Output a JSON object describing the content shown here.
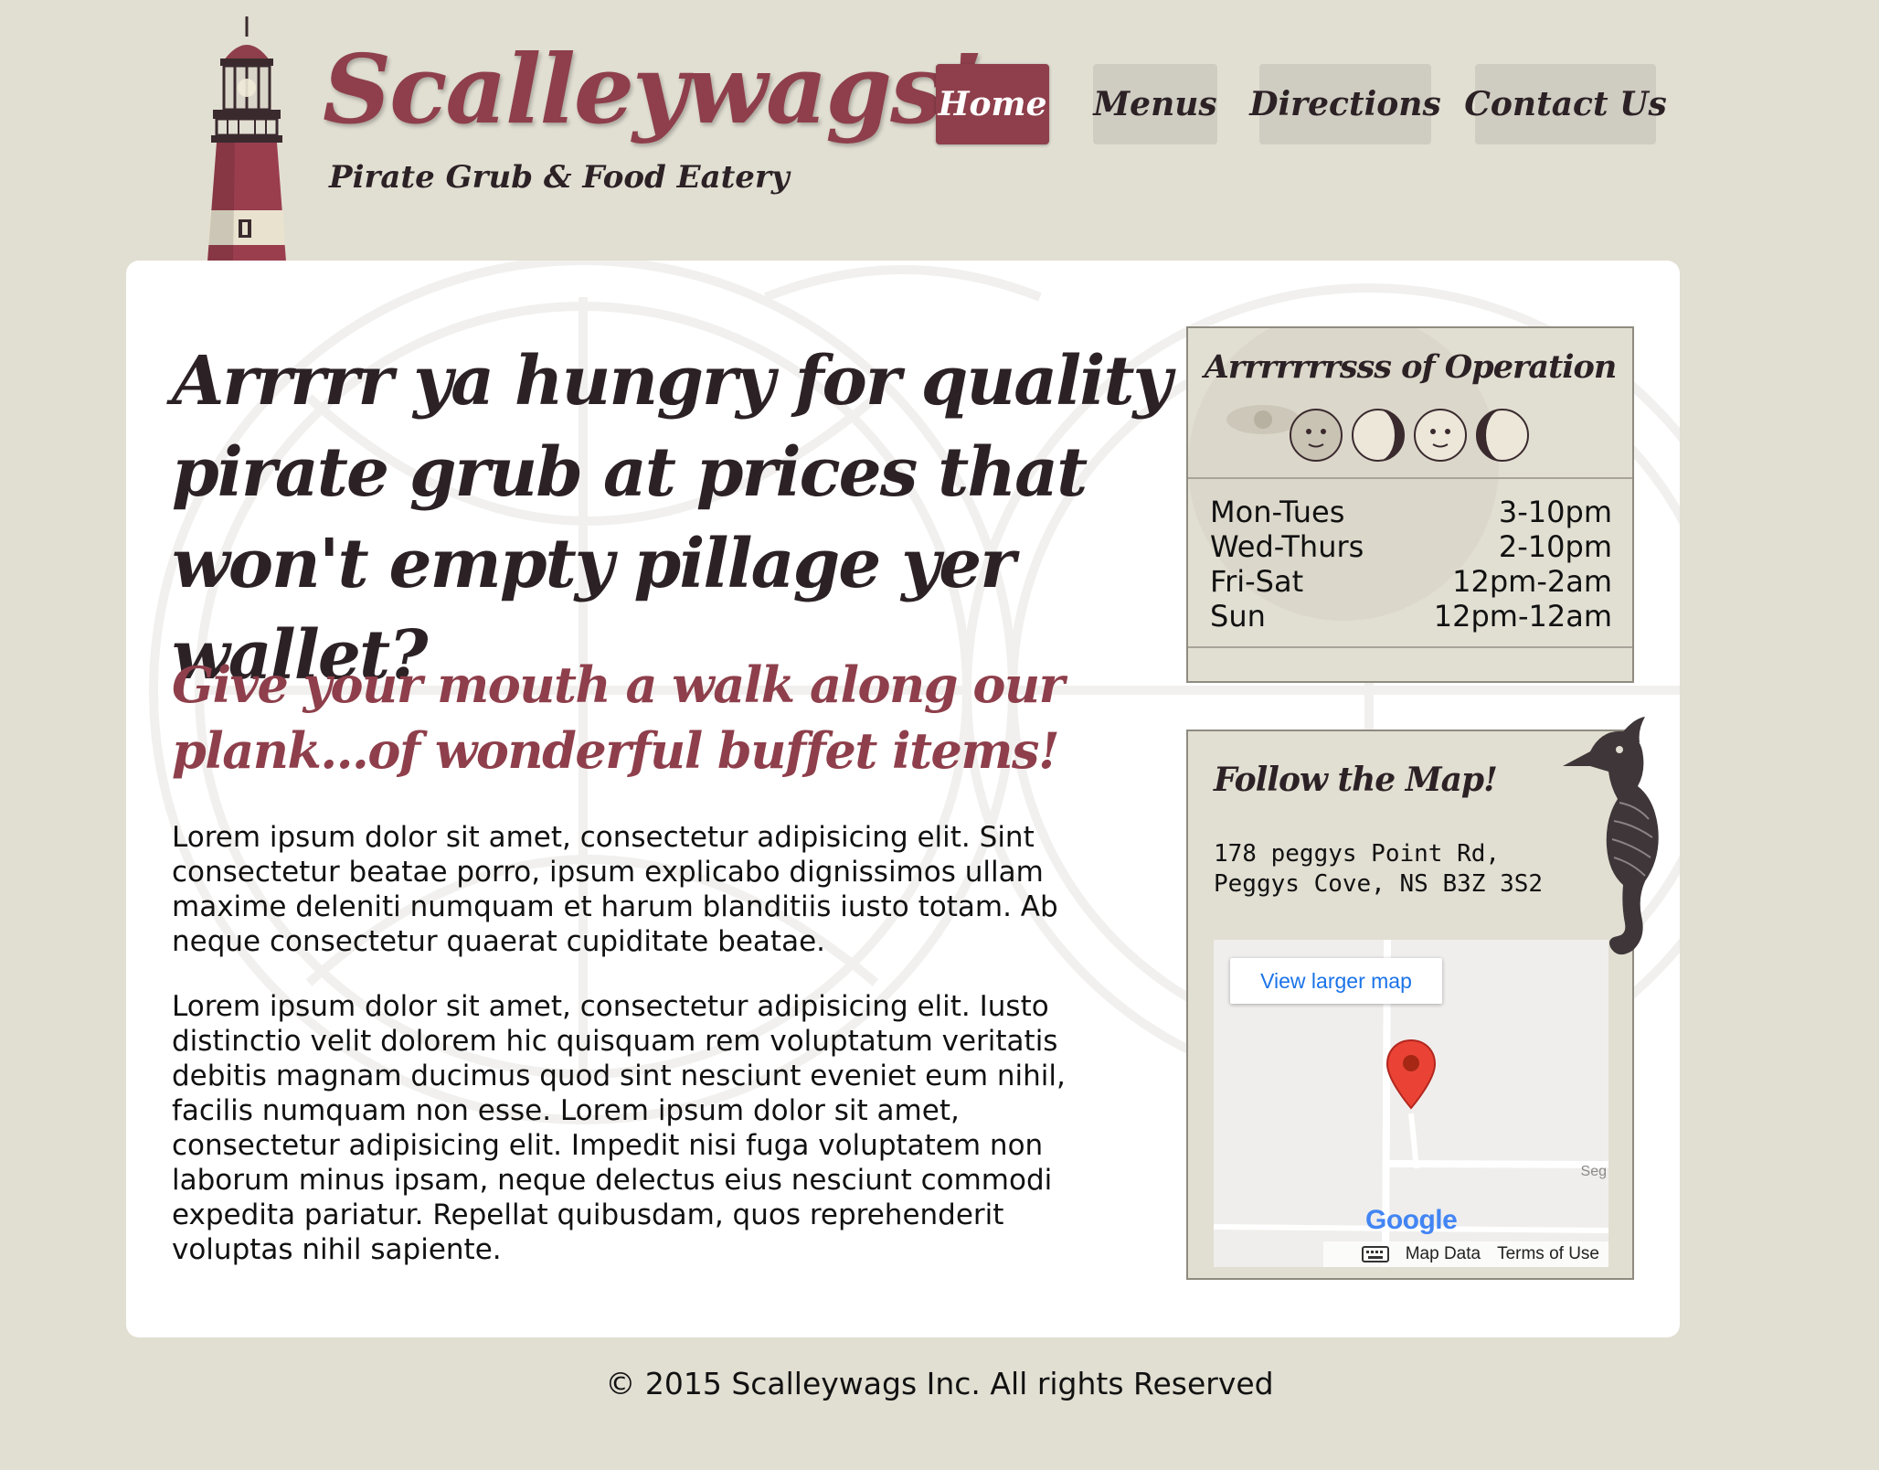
{
  "header": {
    "brand_title": "Scalleywags!",
    "brand_tagline": "Pirate Grub & Food Eatery",
    "logo_icon": "lighthouse-icon"
  },
  "nav": {
    "items": [
      {
        "label": "Home",
        "active": true
      },
      {
        "label": "Menus",
        "active": false
      },
      {
        "label": "Directions",
        "active": false
      },
      {
        "label": "Contact Us",
        "active": false
      }
    ]
  },
  "main": {
    "headline": "Arrrrr ya hungry for quality pirate grub at prices that won't empty pillage yer wallet?",
    "subhead": "Give your mouth a walk along our plank...of wonderful buffet items!",
    "paragraphs": [
      "Lorem ipsum dolor sit amet, consectetur adipisicing elit. Sint consectetur beatae porro, ipsum explicabo dignissimos ullam maxime deleniti numquam et harum blanditiis iusto totam. Ab neque consectetur quaerat cupiditate beatae.",
      "Lorem ipsum dolor sit amet, consectetur adipisicing elit. Iusto distinctio velit dolorem hic quisquam rem voluptatum veritatis debitis magnam ducimus quod sint nesciunt eveniet eum nihil, facilis numquam non esse. Lorem ipsum dolor sit amet, consectetur adipisicing elit. Impedit nisi fuga voluptatem non laborum minus ipsam, neque delectus eius nesciunt commodi expedita pariatur. Repellat quibusdam, quos reprehenderit voluptas nihil sapiente."
    ]
  },
  "hours": {
    "title": "Arrrrrrrsss of Operation",
    "rows": [
      {
        "day": "Mon-Tues",
        "time": "3-10pm"
      },
      {
        "day": "Wed-Thurs",
        "time": "2-10pm"
      },
      {
        "day": "Fri-Sat",
        "time": "12pm-2am"
      },
      {
        "day": "Sun",
        "time": "12pm-12am"
      }
    ]
  },
  "map": {
    "title": "Follow the Map!",
    "address_line1": "178 peggys Point Rd,",
    "address_line2": "Peggys Cove, NS B3Z 3S2",
    "view_larger": "View larger map",
    "road_label": "Seg",
    "logo_text": "Google",
    "map_data": "Map Data",
    "terms": "Terms of Use"
  },
  "footer": {
    "copyright": "© 2015 Scalleywags Inc. All rights Reserved"
  },
  "colors": {
    "brand": "#8e3f4b",
    "page_bg": "#e1ded2",
    "dark_text": "#2c2226",
    "nav_bg": "#cfccc1"
  }
}
